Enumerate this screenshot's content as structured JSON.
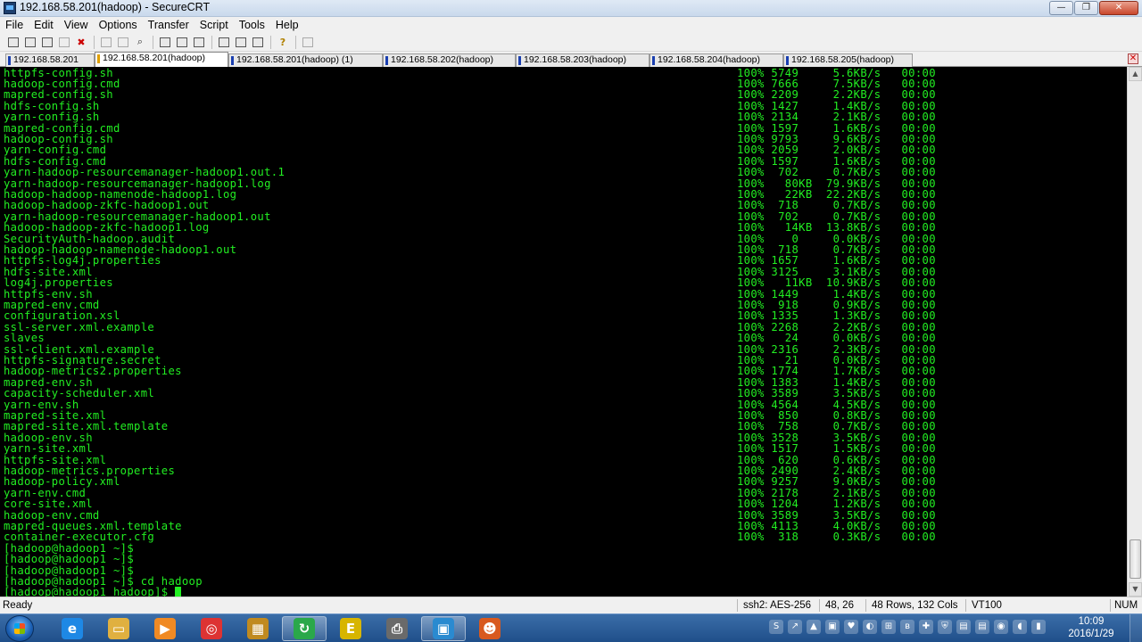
{
  "window": {
    "title": "192.168.58.201(hadoop) - SecureCRT"
  },
  "menu": [
    "File",
    "Edit",
    "View",
    "Options",
    "Transfer",
    "Script",
    "Tools",
    "Help"
  ],
  "toolbar_icons": [
    "connect-icon",
    "quick-connect-icon",
    "connect-tab-icon",
    "reconnect-icon",
    "disconnect-icon",
    "copy-icon",
    "paste-icon",
    "find-icon",
    "print-screen-icon",
    "print-selection-icon",
    "print-icon",
    "session-options-icon",
    "global-options-icon",
    "keymap-icon",
    "help-icon",
    "about-icon"
  ],
  "tabs": [
    {
      "label": "192.168.58.201",
      "active": false
    },
    {
      "label": "192.168.58.201(hadoop)",
      "active": true
    },
    {
      "label": "192.168.58.201(hadoop) (1)",
      "active": false
    },
    {
      "label": "192.168.58.202(hadoop)",
      "active": false
    },
    {
      "label": "192.168.58.203(hadoop)",
      "active": false
    },
    {
      "label": "192.168.58.204(hadoop)",
      "active": false
    },
    {
      "label": "192.168.58.205(hadoop)",
      "active": false
    }
  ],
  "terminal": {
    "transfers": [
      [
        "httpfs-config.sh",
        "100% 5749     5.6KB/s   00:00"
      ],
      [
        "hadoop-config.cmd",
        "100% 7666     7.5KB/s   00:00"
      ],
      [
        "mapred-config.sh",
        "100% 2209     2.2KB/s   00:00"
      ],
      [
        "hdfs-config.sh",
        "100% 1427     1.4KB/s   00:00"
      ],
      [
        "yarn-config.sh",
        "100% 2134     2.1KB/s   00:00"
      ],
      [
        "mapred-config.cmd",
        "100% 1597     1.6KB/s   00:00"
      ],
      [
        "hadoop-config.sh",
        "100% 9793     9.6KB/s   00:00"
      ],
      [
        "yarn-config.cmd",
        "100% 2059     2.0KB/s   00:00"
      ],
      [
        "hdfs-config.cmd",
        "100% 1597     1.6KB/s   00:00"
      ],
      [
        "yarn-hadoop-resourcemanager-hadoop1.out.1",
        "100%  702     0.7KB/s   00:00"
      ],
      [
        "yarn-hadoop-resourcemanager-hadoop1.log",
        "100%   80KB  79.9KB/s   00:00"
      ],
      [
        "hadoop-hadoop-namenode-hadoop1.log",
        "100%   22KB  22.2KB/s   00:00"
      ],
      [
        "hadoop-hadoop-zkfc-hadoop1.out",
        "100%  718     0.7KB/s   00:00"
      ],
      [
        "yarn-hadoop-resourcemanager-hadoop1.out",
        "100%  702     0.7KB/s   00:00"
      ],
      [
        "hadoop-hadoop-zkfc-hadoop1.log",
        "100%   14KB  13.8KB/s   00:00"
      ],
      [
        "SecurityAuth-hadoop.audit",
        "100%    0     0.0KB/s   00:00"
      ],
      [
        "hadoop-hadoop-namenode-hadoop1.out",
        "100%  718     0.7KB/s   00:00"
      ],
      [
        "httpfs-log4j.properties",
        "100% 1657     1.6KB/s   00:00"
      ],
      [
        "hdfs-site.xml",
        "100% 3125     3.1KB/s   00:00"
      ],
      [
        "log4j.properties",
        "100%   11KB  10.9KB/s   00:00"
      ],
      [
        "httpfs-env.sh",
        "100% 1449     1.4KB/s   00:00"
      ],
      [
        "mapred-env.cmd",
        "100%  918     0.9KB/s   00:00"
      ],
      [
        "configuration.xsl",
        "100% 1335     1.3KB/s   00:00"
      ],
      [
        "ssl-server.xml.example",
        "100% 2268     2.2KB/s   00:00"
      ],
      [
        "slaves",
        "100%   24     0.0KB/s   00:00"
      ],
      [
        "ssl-client.xml.example",
        "100% 2316     2.3KB/s   00:00"
      ],
      [
        "httpfs-signature.secret",
        "100%   21     0.0KB/s   00:00"
      ],
      [
        "hadoop-metrics2.properties",
        "100% 1774     1.7KB/s   00:00"
      ],
      [
        "mapred-env.sh",
        "100% 1383     1.4KB/s   00:00"
      ],
      [
        "capacity-scheduler.xml",
        "100% 3589     3.5KB/s   00:00"
      ],
      [
        "yarn-env.sh",
        "100% 4564     4.5KB/s   00:00"
      ],
      [
        "mapred-site.xml",
        "100%  850     0.8KB/s   00:00"
      ],
      [
        "mapred-site.xml.template",
        "100%  758     0.7KB/s   00:00"
      ],
      [
        "hadoop-env.sh",
        "100% 3528     3.5KB/s   00:00"
      ],
      [
        "yarn-site.xml",
        "100% 1517     1.5KB/s   00:00"
      ],
      [
        "httpfs-site.xml",
        "100%  620     0.6KB/s   00:00"
      ],
      [
        "hadoop-metrics.properties",
        "100% 2490     2.4KB/s   00:00"
      ],
      [
        "hadoop-policy.xml",
        "100% 9257     9.0KB/s   00:00"
      ],
      [
        "yarn-env.cmd",
        "100% 2178     2.1KB/s   00:00"
      ],
      [
        "core-site.xml",
        "100% 1204     1.2KB/s   00:00"
      ],
      [
        "hadoop-env.cmd",
        "100% 3589     3.5KB/s   00:00"
      ],
      [
        "mapred-queues.xml.template",
        "100% 4113     4.0KB/s   00:00"
      ],
      [
        "container-executor.cfg",
        "100%  318     0.3KB/s   00:00"
      ]
    ],
    "prompts": [
      "[hadoop@hadoop1 ~]$",
      "[hadoop@hadoop1 ~]$",
      "[hadoop@hadoop1 ~]$",
      "[hadoop@hadoop1 ~]$ cd hadoop",
      "[hadoop@hadoop1 hadoop]$"
    ]
  },
  "status": {
    "ready": "Ready",
    "cipher": "ssh2: AES-256",
    "cursor_pos": "48, 26",
    "size": "48 Rows, 132 Cols",
    "emulation": "VT100",
    "num": "NUM"
  },
  "taskbar": {
    "apps": [
      {
        "name": "ie-icon",
        "glyph": "e",
        "color": "#1e88e5",
        "active": false
      },
      {
        "name": "explorer-icon",
        "glyph": "▭",
        "color": "#e0b040",
        "active": false
      },
      {
        "name": "media-player-icon",
        "glyph": "▶",
        "color": "#f08a24",
        "active": false
      },
      {
        "name": "chrome-icon",
        "glyph": "◎",
        "color": "#d33",
        "active": false
      },
      {
        "name": "file-manager-icon",
        "glyph": "▦",
        "color": "#c08a20",
        "active": false
      },
      {
        "name": "refresh-app-icon",
        "glyph": "↻",
        "color": "#2aa84a",
        "active": true
      },
      {
        "name": "editor-app-icon",
        "glyph": "E",
        "color": "#d7b500",
        "active": false
      },
      {
        "name": "printer-app-icon",
        "glyph": "⎙",
        "color": "#6a6a6a",
        "active": false
      },
      {
        "name": "securecrt-taskbar-icon",
        "glyph": "▣",
        "color": "#2a8ad0",
        "active": true
      },
      {
        "name": "game-app-icon",
        "glyph": "☻",
        "color": "#d85a20",
        "active": false
      }
    ],
    "tray": [
      "S",
      "↗",
      "▲",
      "▣",
      "♥",
      "◐",
      "⊞",
      "ʙ",
      "✚",
      "⛨",
      "▤",
      "▤",
      "◉",
      "◖",
      "▮"
    ],
    "time": "10:09",
    "date": "2016/1/29"
  }
}
